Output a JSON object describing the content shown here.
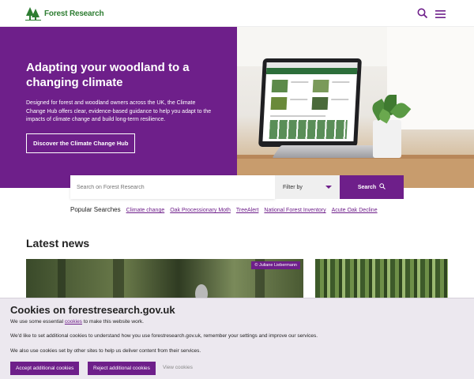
{
  "header": {
    "logo_text": "Forest Research",
    "search_icon": "search-icon",
    "menu_icon": "hamburger-menu-icon"
  },
  "hero": {
    "title": "Adapting your woodland to a changing climate",
    "description": "Designed for forest and woodland owners across the UK, the Climate Change Hub offers clear, evidence-based guidance to help you adapt to the impacts of climate change and build long-term resilience.",
    "button_label": "Discover the Climate Change Hub"
  },
  "search": {
    "placeholder": "Search on Forest Research",
    "filter_label": "Filter by",
    "button_label": "Search"
  },
  "popular": {
    "label": "Popular Searches",
    "links": [
      "Climate change",
      "Oak Processionary Moth",
      "TreeAlert",
      "National Forest Inventory",
      "Acute Oak Decline"
    ]
  },
  "news": {
    "heading": "Latest news",
    "main_credit": "© Juliane Liebermann"
  },
  "cookie": {
    "title": "Cookies on forestresearch.gov.uk",
    "p1_before": "We use some essential ",
    "p1_link": "cookies",
    "p1_after": " to make this website work.",
    "p2": "We'd like to set additional cookies to understand how you use forestresearch.gov.uk, remember your settings and improve our services.",
    "p3": "We also use cookies set by other sites to help us deliver content from their services.",
    "accept_label": "Accept additional cookies",
    "reject_label": "Reject additional cookies",
    "view_label": "View cookies"
  },
  "colors": {
    "brand_purple": "#6e1f8a",
    "brand_green": "#2e7d32"
  }
}
